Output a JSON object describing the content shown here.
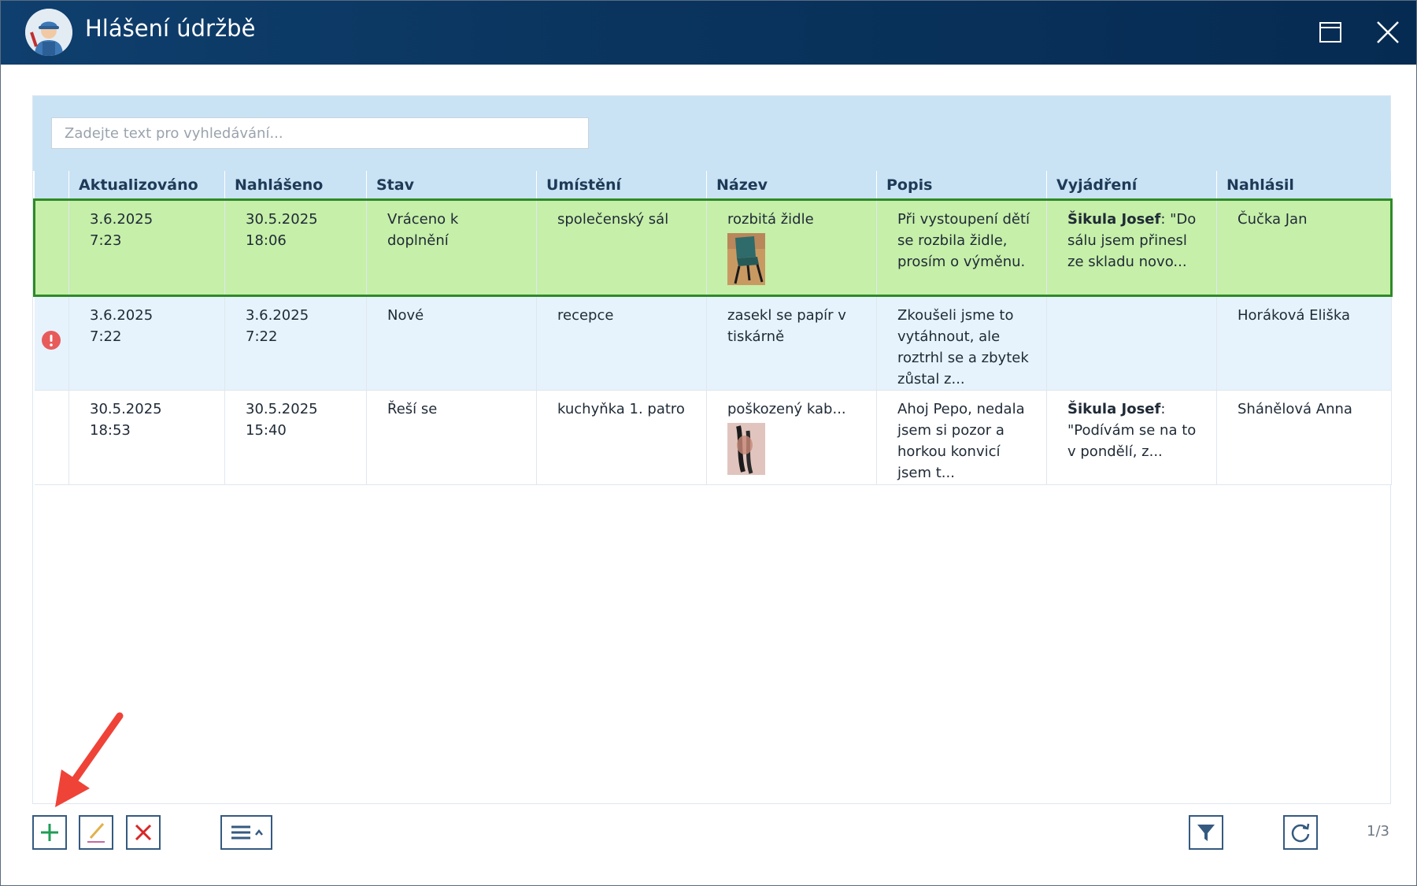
{
  "window": {
    "title": "Hlášení údržbě"
  },
  "search": {
    "placeholder": "Zadejte text pro vyhledávání..."
  },
  "table": {
    "columns": [
      "Aktualizováno",
      "Nahlášeno",
      "Stav",
      "Umístění",
      "Název",
      "Popis",
      "Vyjádření",
      "Nahlásil"
    ],
    "rows": [
      {
        "aktualizovano": [
          "3.6.2025",
          "7:23"
        ],
        "nahlaseno": [
          "30.5.2025",
          "18:06"
        ],
        "stav": [
          "Vráceno k",
          "doplnění"
        ],
        "umisteni": "společenský sál",
        "nazev": "rozbitá židle",
        "popis": [
          "Při vystoupení dětí",
          "se rozbila židle,",
          "prosím o výměnu."
        ],
        "vyjadreni_author": "Šikula Josef",
        "vyjadreni": [
          ": \"Do",
          "sálu jsem přinesl",
          "ze skladu novo..."
        ],
        "nahlasil": "Čučka Jan",
        "selected": true
      },
      {
        "aktualizovano": [
          "3.6.2025",
          "7:22"
        ],
        "nahlaseno": [
          "3.6.2025",
          "7:22"
        ],
        "stav": [
          "Nové"
        ],
        "umisteni": "recepce",
        "nazev": [
          "zasekl se papír v",
          "tiskárně"
        ],
        "popis": [
          "Zkoušeli jsme to",
          "vytáhnout, ale",
          "roztrhl se a zbytek",
          "zůstal z..."
        ],
        "nahlasil": "Horáková Eliška",
        "warning_icon": "error-icon"
      },
      {
        "aktualizovano": [
          "30.5.2025",
          "18:53"
        ],
        "nahlaseno": [
          "30.5.2025",
          "15:40"
        ],
        "stav": [
          "Řeší se"
        ],
        "umisteni": "kuchyňka 1. patro",
        "nazev": "poškozený kab...",
        "popis": [
          "Ahoj Pepo, nedala",
          "jsem si pozor a",
          "horkou konvicí",
          "jsem t..."
        ],
        "vyjadreni_author": "Šikula Josef",
        "vyjadreni": [
          ":",
          "\"Podívám se na to",
          "v pondělí, z..."
        ],
        "nahlasil": "Shánělová Anna"
      }
    ]
  },
  "footer": {
    "pager": "1/3"
  },
  "colors": {
    "titlebar": "#0a355f",
    "header_band": "#c9e3f5",
    "selected_row": "#c6efa9",
    "selected_border": "#2f8a26",
    "alt_row": "#e6f3fc",
    "error": "#e85b5b",
    "add": "#1f9d55",
    "delete": "#d82727"
  }
}
